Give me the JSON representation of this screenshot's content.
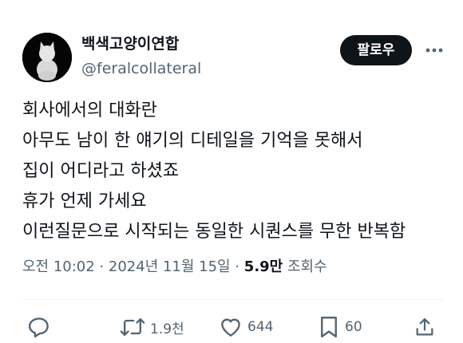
{
  "user": {
    "display_name": "백색고양이연합",
    "handle": "@feralcollateral"
  },
  "follow_button": {
    "label": "팔로우"
  },
  "post": {
    "lines": [
      "회사에서의 대화란",
      "아무도 남이 한 얘기의 디테일을 기억을 못해서",
      "집이 어디라고 하셨죠",
      "휴가 언제 가세요",
      "이런질문으로 시작되는 동일한 시퀀스를 무한 반복함"
    ]
  },
  "meta": {
    "timestamp": "오전 10:02 · 2024년 11월 15일",
    "separator": " · ",
    "views_count": "5.9만",
    "views_label": " 조회수"
  },
  "actions": {
    "retweets": "1.9천",
    "likes": "644",
    "bookmarks": "60"
  },
  "icons": {
    "more": "more-horizontal-icon",
    "reply": "reply-icon",
    "retweet": "retweet-icon",
    "like": "heart-icon",
    "bookmark": "bookmark-icon",
    "share": "share-icon"
  }
}
